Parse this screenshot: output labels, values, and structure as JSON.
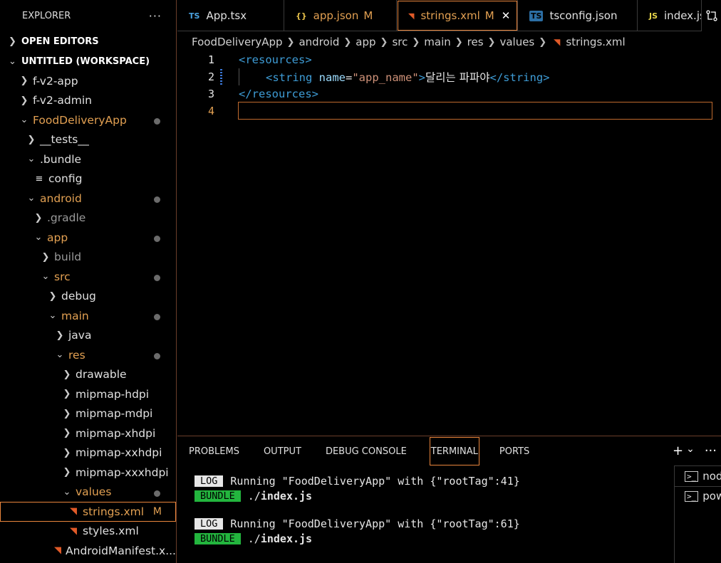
{
  "sidebar": {
    "title": "EXPLORER",
    "more": "···",
    "open_editors": "OPEN EDITORS",
    "workspace": "UNTITLED (WORKSPACE)",
    "items": [
      {
        "label": "f-v2-app"
      },
      {
        "label": "f-v2-admin"
      },
      {
        "label": "FoodDeliveryApp"
      },
      {
        "label": "__tests__"
      },
      {
        "label": ".bundle"
      },
      {
        "label": "config"
      },
      {
        "label": "android"
      },
      {
        "label": ".gradle"
      },
      {
        "label": "app"
      },
      {
        "label": "build"
      },
      {
        "label": "src"
      },
      {
        "label": "debug"
      },
      {
        "label": "main"
      },
      {
        "label": "java"
      },
      {
        "label": "res"
      },
      {
        "label": "drawable"
      },
      {
        "label": "mipmap-hdpi"
      },
      {
        "label": "mipmap-mdpi"
      },
      {
        "label": "mipmap-xhdpi"
      },
      {
        "label": "mipmap-xxhdpi"
      },
      {
        "label": "mipmap-xxxhdpi"
      },
      {
        "label": "values"
      },
      {
        "label": "strings.xml",
        "badge": "M"
      },
      {
        "label": "styles.xml"
      },
      {
        "label": "AndroidManifest.x..."
      }
    ]
  },
  "tabs": [
    {
      "icon": "TS",
      "label": "App.tsx"
    },
    {
      "icon": "{}",
      "label": "app.json",
      "badge": "M"
    },
    {
      "icon": "rss",
      "label": "strings.xml",
      "badge": "M",
      "close": "✕"
    },
    {
      "icon": "TS",
      "label": "tsconfig.json"
    },
    {
      "icon": "JS",
      "label": "index.js"
    }
  ],
  "breadcrumb": [
    "FoodDeliveryApp",
    "android",
    "app",
    "src",
    "main",
    "res",
    "values",
    "strings.xml"
  ],
  "editor": {
    "lines": [
      {
        "num": "1"
      },
      {
        "num": "2",
        "text": "달리는 파파야"
      },
      {
        "num": "3"
      },
      {
        "num": "4"
      }
    ],
    "code": {
      "open_tag": "<resources>",
      "close_tag": "</resources>",
      "string_open": "<string",
      "attr_name": "name",
      "attr_eq": "=",
      "attr_value": "\"app_name\"",
      "gt": ">",
      "string_close": "</string>"
    }
  },
  "panel": {
    "tabs": [
      "PROBLEMS",
      "OUTPUT",
      "DEBUG CONSOLE",
      "TERMINAL",
      "PORTS"
    ],
    "actions": {
      "add": "+",
      "dropdown": "⌄",
      "more": "···"
    },
    "terminal": [
      {
        "badge": "LOG",
        "text": "Running \"FoodDeliveryApp\" with {\"rootTag\":41}"
      },
      {
        "badge": "BUNDLE",
        "prefix": "./",
        "file": "index.js"
      },
      {
        "badge": "LOG",
        "text": "Running \"FoodDeliveryApp\" with {\"rootTag\":61}"
      },
      {
        "badge": "BUNDLE",
        "prefix": "./",
        "file": "index.js"
      }
    ],
    "terminal_list": [
      {
        "label": "nod"
      },
      {
        "label": "pow"
      }
    ]
  },
  "colors": {
    "accent_border": "#e9853c",
    "modified": "#e2a052",
    "xml_tag": "#3e9cd6",
    "xml_attr": "#9cdcfe",
    "xml_string": "#ce9178",
    "bundle_green": "#23b53e"
  }
}
